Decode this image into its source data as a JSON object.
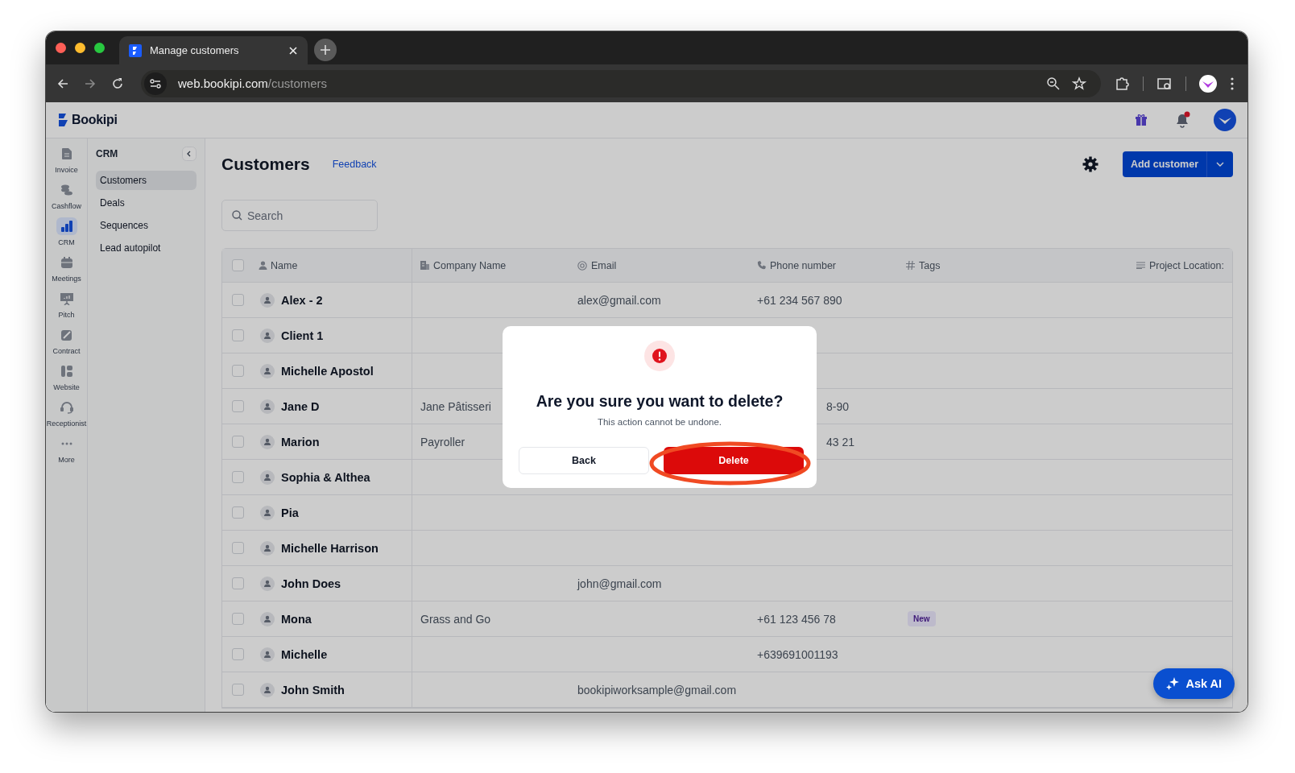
{
  "browser": {
    "tab_title": "Manage customers",
    "url_host": "web.bookipi.com",
    "url_path": "/customers"
  },
  "app": {
    "logo": "Bookipi",
    "notification_unread": true
  },
  "rail": [
    {
      "kind": "invoice",
      "label": "Invoice",
      "selected": false
    },
    {
      "kind": "cashflow",
      "label": "Cashflow",
      "selected": false
    },
    {
      "kind": "crm",
      "label": "CRM",
      "selected": true
    },
    {
      "kind": "meetings",
      "label": "Meetings",
      "selected": false
    },
    {
      "kind": "pitch",
      "label": "Pitch",
      "selected": false
    },
    {
      "kind": "contract",
      "label": "Contract",
      "selected": false
    },
    {
      "kind": "website",
      "label": "Website",
      "selected": false
    },
    {
      "kind": "receptionist",
      "label": "Receptionist",
      "selected": false
    },
    {
      "kind": "more",
      "label": "More",
      "selected": false
    }
  ],
  "crm_menu": {
    "title": "CRM",
    "items": [
      {
        "label": "Customers",
        "selected": true
      },
      {
        "label": "Deals",
        "selected": false
      },
      {
        "label": "Sequences",
        "selected": false
      },
      {
        "label": "Lead autopilot",
        "selected": false
      }
    ]
  },
  "page": {
    "title": "Customers",
    "feedback": "Feedback",
    "add_button": "Add customer"
  },
  "search": {
    "placeholder": "Search"
  },
  "table": {
    "all_checked": false,
    "columns": [
      {
        "kind": "person",
        "label": "Name"
      },
      {
        "kind": "building",
        "label": "Company Name"
      },
      {
        "kind": "at",
        "label": "Email"
      },
      {
        "kind": "phone",
        "label": "Phone number"
      },
      {
        "kind": "hash",
        "label": "Tags"
      },
      {
        "kind": "lines",
        "label": "Project Location:"
      }
    ],
    "rows": [
      {
        "name": "Alex - 2",
        "email": "alex@gmail.com",
        "phone": "+61 234 567 890",
        "checked": false
      },
      {
        "name": "Client 1",
        "checked": false
      },
      {
        "name": "Michelle Apostol",
        "checked": false
      },
      {
        "name": "Jane D",
        "company": "Jane Pâtisseri",
        "phone": "8-90",
        "phone_cut": true,
        "checked": false
      },
      {
        "name": "Marion",
        "company": "Payroller",
        "phone": "43 21",
        "phone_cut": true,
        "checked": false
      },
      {
        "name": "Sophia & Althea",
        "checked": false
      },
      {
        "name": "Pia",
        "checked": false
      },
      {
        "name": "Michelle Harrison",
        "checked": false
      },
      {
        "name": "John Does",
        "email": "john@gmail.com",
        "checked": false
      },
      {
        "name": "Mona",
        "company": "Grass and Go",
        "phone": "+61 123 456 78",
        "tags": [
          "New"
        ],
        "checked": false
      },
      {
        "name": "Michelle",
        "phone": "+639691001193",
        "checked": false
      },
      {
        "name": "John Smith",
        "email": "bookipiworksample@gmail.com",
        "checked": false
      }
    ]
  },
  "dialog": {
    "title": "Are you sure you want to delete?",
    "message": "This action cannot be undone.",
    "buttons": [
      {
        "kind": "secondary",
        "label": "Back"
      },
      {
        "kind": "danger",
        "label": "Delete"
      }
    ]
  },
  "ask_ai": {
    "label": "Ask AI"
  }
}
